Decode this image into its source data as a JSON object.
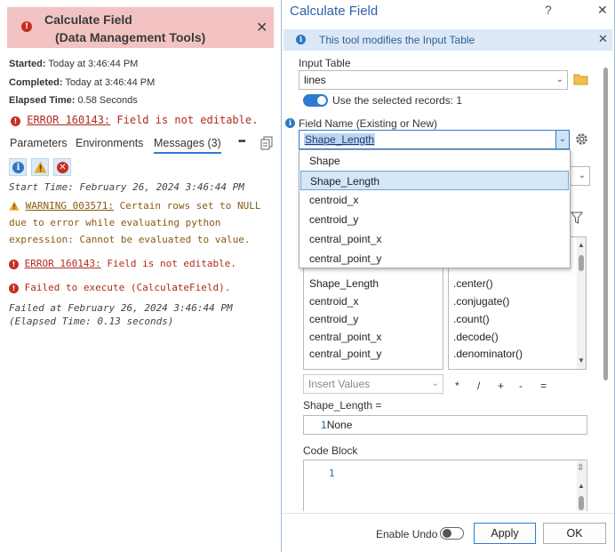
{
  "left_panel": {
    "title_line1": "Calculate Field",
    "title_line2": "(Data Management Tools)",
    "started_label": "Started:",
    "started_value": "Today at 3:46:44 PM",
    "completed_label": "Completed:",
    "completed_value": "Today at 3:46:44 PM",
    "elapsed_label": "Elapsed Time:",
    "elapsed_value": "0.58 Seconds",
    "top_error_code": "ERROR 160143:",
    "top_error_text": "Field is not editable.",
    "tabs": [
      {
        "label": "Parameters"
      },
      {
        "label": "Environments"
      },
      {
        "label": "Messages (3)"
      }
    ],
    "more_label": "•••",
    "messages": {
      "start_time": "Start Time: February 26, 2024 3:46:44 PM",
      "warning_code": "WARNING 003571:",
      "warning_text_1": "Certain rows set to NULL",
      "warning_text_2": "due to error while evaluating python",
      "warning_text_3": "expression: Cannot be evaluated to value.",
      "error_code": "ERROR 160143:",
      "error_text": "Field is not editable.",
      "failed_exec": "Failed to execute (CalculateField).",
      "failed_at_1": "Failed at February 26, 2024 3:46:44 PM",
      "failed_at_2": "(Elapsed Time: 0.13 seconds)"
    }
  },
  "dialog": {
    "title": "Calculate Field",
    "help_label": "?",
    "info_text": "This tool modifies the Input Table",
    "input_table_label": "Input Table",
    "input_table_value": "lines",
    "use_selected_label": "Use the selected records: 1",
    "field_name_label": "Field Name (Existing or New)",
    "field_name_value": "Shape_Length",
    "dropdown_options": [
      "Shape",
      "Shape_Length",
      "centroid_x",
      "centroid_y",
      "central_point_x",
      "central_point_y"
    ],
    "fields_list": [
      "Shape_Length",
      "centroid_x",
      "centroid_y",
      "central_point_x",
      "central_point_y"
    ],
    "helpers_list": [
      ".center()",
      ".conjugate()",
      ".count()",
      ".decode()",
      ".denominator()"
    ],
    "insert_values_label": "Insert Values",
    "operators": [
      "*",
      "/",
      "+",
      "-",
      "="
    ],
    "expression_label": "Shape_Length =",
    "expression_line_no": "1",
    "expression_value": "None",
    "code_block_label": "Code Block",
    "code_block_line_no": "1",
    "enable_undo_label": "Enable Undo",
    "apply_label": "Apply",
    "ok_label": "OK"
  },
  "colors": {
    "accent": "#2c7bd0",
    "error": "#c62f22",
    "warning": "#e0a020",
    "header_error_bg": "#f3c3c3",
    "info_bar_bg": "#dce8f5"
  }
}
